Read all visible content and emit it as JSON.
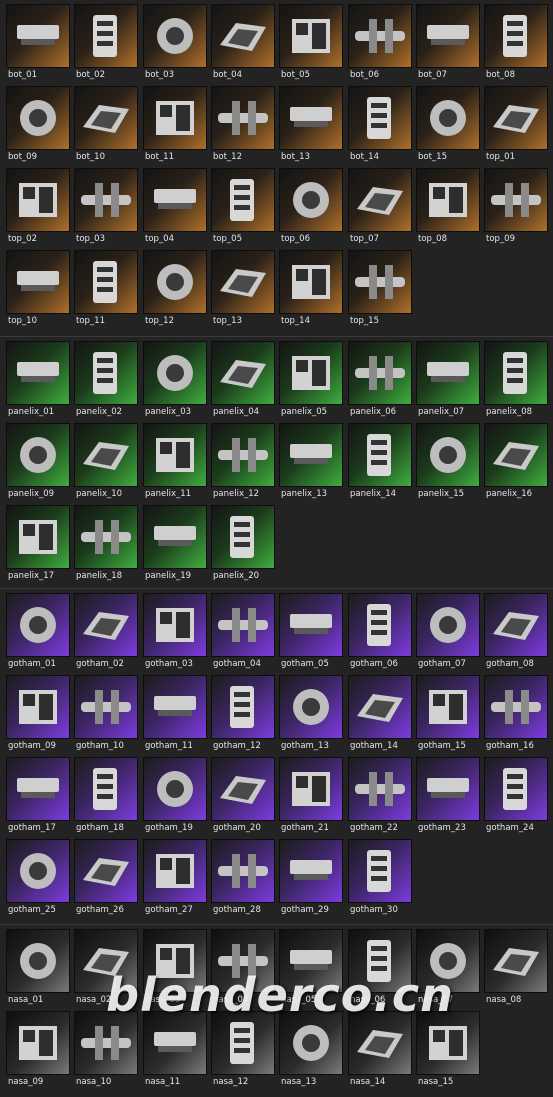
{
  "browser": {
    "sections": [
      {
        "key": "bot",
        "accent": "#b0702a",
        "items": [
          "bot_01",
          "bot_02",
          "bot_03",
          "bot_04",
          "bot_05",
          "bot_06",
          "bot_07",
          "bot_08",
          "bot_09",
          "bot_10",
          "bot_11",
          "bot_12",
          "bot_13",
          "bot_14",
          "bot_15",
          "top_01",
          "top_02",
          "top_03",
          "top_04",
          "top_05",
          "top_06",
          "top_07",
          "top_08",
          "top_09",
          "top_10",
          "top_11",
          "top_12",
          "top_13",
          "top_14",
          "top_15"
        ]
      },
      {
        "key": "pan",
        "accent": "#3fae3f",
        "items": [
          "panelix_01",
          "panelix_02",
          "panelix_03",
          "panelix_04",
          "panelix_05",
          "panelix_06",
          "panelix_07",
          "panelix_08",
          "panelix_09",
          "panelix_10",
          "panelix_11",
          "panelix_12",
          "panelix_13",
          "panelix_14",
          "panelix_15",
          "panelix_16",
          "panelix_17",
          "panelix_18",
          "panelix_19",
          "panelix_20"
        ]
      },
      {
        "key": "got",
        "accent": "#7e3be0",
        "items": [
          "gotham_01",
          "gotham_02",
          "gotham_03",
          "gotham_04",
          "gotham_05",
          "gotham_06",
          "gotham_07",
          "gotham_08",
          "gotham_09",
          "gotham_10",
          "gotham_11",
          "gotham_12",
          "gotham_13",
          "gotham_14",
          "gotham_15",
          "gotham_16",
          "gotham_17",
          "gotham_18",
          "gotham_19",
          "gotham_20",
          "gotham_21",
          "gotham_22",
          "gotham_23",
          "gotham_24",
          "gotham_25",
          "gotham_26",
          "gotham_27",
          "gotham_28",
          "gotham_29",
          "gotham_30"
        ]
      },
      {
        "key": "nas",
        "accent": "#7a7a7a",
        "items": [
          "nasa_01",
          "nasa_02",
          "nasa_03",
          "nasa_04",
          "nasa_05",
          "nasa_06",
          "nasa_07",
          "nasa_08",
          "nasa_09",
          "nasa_10",
          "nasa_11",
          "nasa_12",
          "nasa_13",
          "nasa_14",
          "nasa_15"
        ]
      }
    ]
  },
  "watermark": "blenderco.cn"
}
